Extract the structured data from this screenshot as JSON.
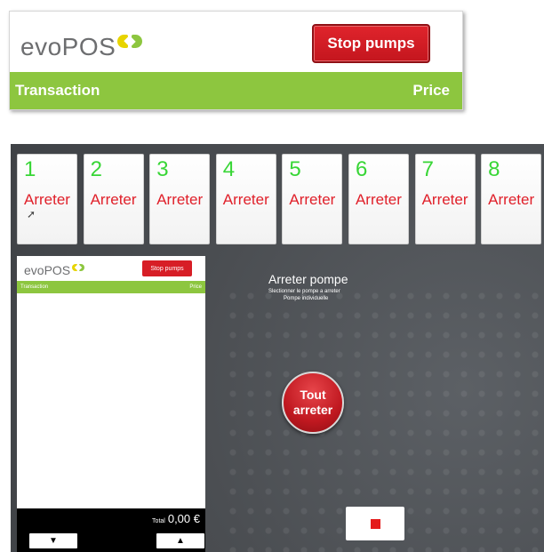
{
  "callout": {
    "logo_text": "evoPOS",
    "stop_button": "Stop pumps",
    "col_transaction": "Transaction",
    "col_price": "Price"
  },
  "pumps": [
    {
      "number": "1",
      "label": "Arreter"
    },
    {
      "number": "2",
      "label": "Arreter"
    },
    {
      "number": "3",
      "label": "Arreter"
    },
    {
      "number": "4",
      "label": "Arreter"
    },
    {
      "number": "5",
      "label": "Arreter"
    },
    {
      "number": "6",
      "label": "Arreter"
    },
    {
      "number": "7",
      "label": "Arreter"
    },
    {
      "number": "8",
      "label": "Arreter"
    }
  ],
  "panel": {
    "logo_text": "evoPOS",
    "stop_button": "Stop pumps",
    "col_transaction": "Transaction",
    "col_price": "Price",
    "total_label": "Total",
    "total_value": "0,00 €",
    "down_arrow": "▼",
    "up_arrow": "▲"
  },
  "main": {
    "heading": "Arreter pompe",
    "sub1": "Slectionner le pompe a arreter",
    "sub2": "Pompe individuelle",
    "tout_line1": "Tout",
    "tout_line2": "arreter"
  },
  "colors": {
    "brand_green": "#8dc63f",
    "stop_red": "#d71e26",
    "pump_number_green": "#38d636",
    "pump_label_red": "#e0202a"
  }
}
